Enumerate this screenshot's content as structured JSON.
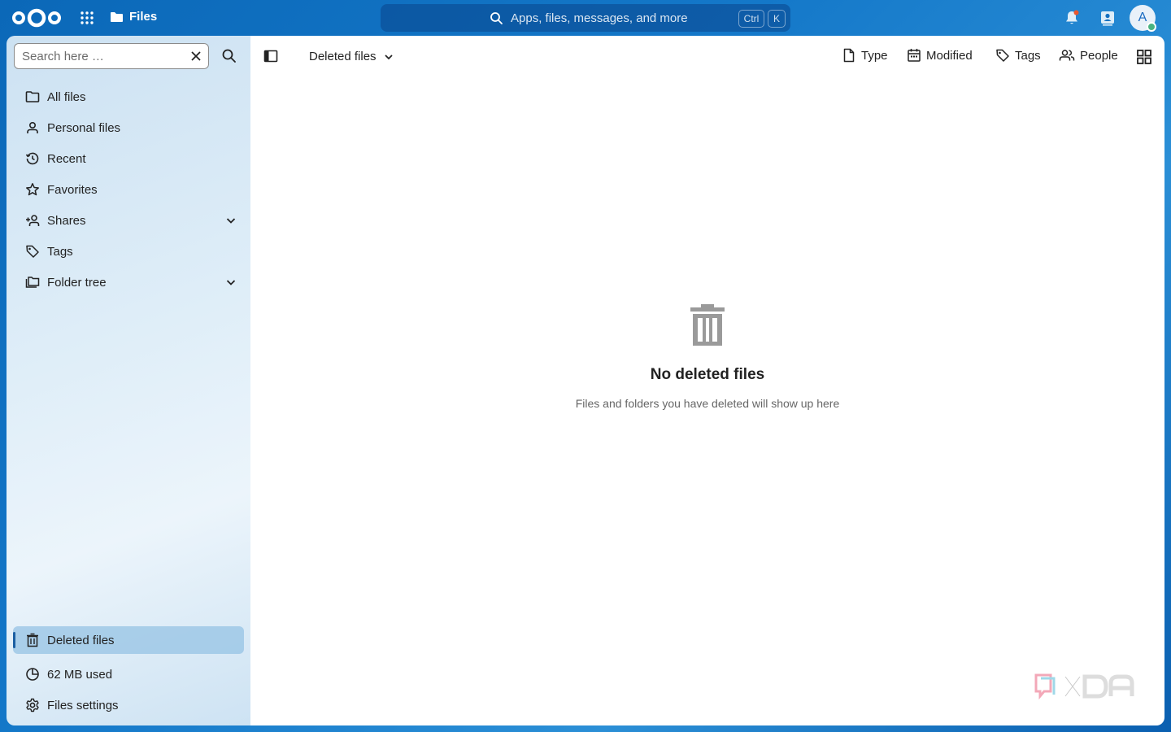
{
  "header": {
    "app_name": "Files",
    "search_placeholder": "Apps, files, messages, and more",
    "shortcut_ctrl": "Ctrl",
    "shortcut_key": "K",
    "avatar_initial": "A"
  },
  "sidebar": {
    "search_placeholder": "Search here …",
    "items": [
      {
        "label": "All files",
        "icon": "folder-icon"
      },
      {
        "label": "Personal files",
        "icon": "user-icon"
      },
      {
        "label": "Recent",
        "icon": "history-icon"
      },
      {
        "label": "Favorites",
        "icon": "star-icon"
      },
      {
        "label": "Shares",
        "icon": "share-icon"
      },
      {
        "label": "Tags",
        "icon": "tag-icon"
      },
      {
        "label": "Folder tree",
        "icon": "folder-multiple-icon"
      }
    ],
    "bottom_items": [
      {
        "label": "Deleted files",
        "icon": "trash-icon",
        "active": true
      },
      {
        "label": "62 MB used",
        "icon": "chart-pie-icon"
      },
      {
        "label": "Files settings",
        "icon": "gear-icon"
      }
    ]
  },
  "main": {
    "view_title": "Deleted files",
    "filters": [
      {
        "label": "Type",
        "icon": "file-icon"
      },
      {
        "label": "Modified",
        "icon": "calendar-icon"
      },
      {
        "label": "Tags",
        "icon": "tag-icon"
      },
      {
        "label": "People",
        "icon": "people-icon"
      }
    ],
    "empty_title": "No deleted files",
    "empty_description": "Files and folders you have deleted will show up here"
  },
  "colors": {
    "header_bg": "#0b68b8",
    "active_item_bg": "#96c3e4",
    "accent": "#1b5fa3"
  }
}
